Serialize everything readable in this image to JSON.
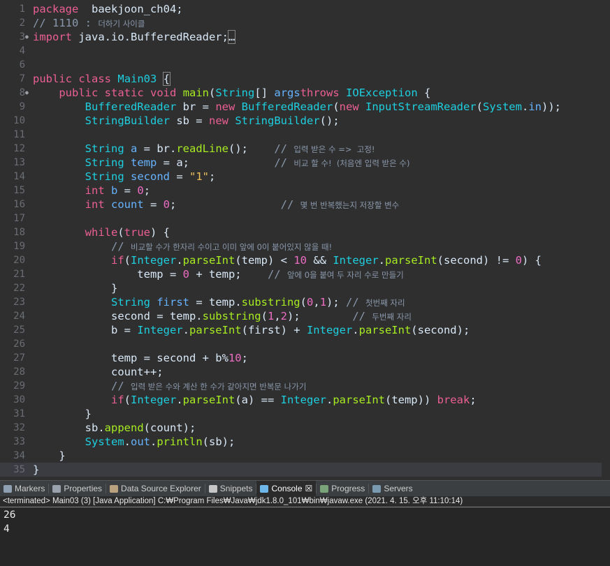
{
  "editor": {
    "lines": [
      {
        "n": "1",
        "segments": [
          [
            "kw",
            "package"
          ],
          [
            "",
            "  baekjoon_ch04;"
          ]
        ]
      },
      {
        "n": "2",
        "segments": [
          [
            "cmt",
            "// 1110 : "
          ],
          [
            "cmtk",
            "더하기 사이클"
          ]
        ]
      },
      {
        "n": "3",
        "fold": true,
        "segments": [
          [
            "kw",
            "import"
          ],
          [
            "",
            " java.io.BufferedReader;"
          ],
          [
            "brk",
            "…"
          ]
        ]
      },
      {
        "n": "4",
        "segments": []
      },
      {
        "n": "6",
        "segments": []
      },
      {
        "n": "7",
        "segments": [
          [
            "kw",
            "public"
          ],
          [
            "",
            " "
          ],
          [
            "kw",
            "class"
          ],
          [
            "",
            " "
          ],
          [
            "cls",
            "Main03"
          ],
          [
            "",
            " "
          ],
          [
            "brk",
            "{"
          ]
        ]
      },
      {
        "n": "8",
        "fold": true,
        "segments": [
          [
            "",
            "    "
          ],
          [
            "kw",
            "public"
          ],
          [
            "",
            " "
          ],
          [
            "kw",
            "static"
          ],
          [
            "",
            " "
          ],
          [
            "kw",
            "void"
          ],
          [
            "",
            " "
          ],
          [
            "meth",
            "main"
          ],
          [
            "",
            "("
          ],
          [
            "cls",
            "String"
          ],
          [
            "",
            "[] "
          ],
          [
            "fld",
            "args"
          ],
          [
            ") "
          ],
          [
            "kw",
            "throws"
          ],
          [
            "",
            " "
          ],
          [
            "cls",
            "IOException"
          ],
          [
            "",
            " {"
          ]
        ]
      },
      {
        "n": "9",
        "segments": [
          [
            "",
            "        "
          ],
          [
            "cls",
            "BufferedReader"
          ],
          [
            "",
            " br = "
          ],
          [
            "kw",
            "new"
          ],
          [
            "",
            " "
          ],
          [
            "cls",
            "BufferedReader"
          ],
          [
            "",
            "("
          ],
          [
            "kw",
            "new"
          ],
          [
            "",
            " "
          ],
          [
            "cls",
            "InputStreamReader"
          ],
          [
            "",
            "("
          ],
          [
            "cls",
            "System"
          ],
          [
            "",
            "."
          ],
          [
            "fld",
            "in"
          ],
          [
            "",
            "));"
          ]
        ]
      },
      {
        "n": "10",
        "segments": [
          [
            "",
            "        "
          ],
          [
            "cls",
            "StringBuilder"
          ],
          [
            "",
            " sb = "
          ],
          [
            "kw",
            "new"
          ],
          [
            "",
            " "
          ],
          [
            "cls",
            "StringBuilder"
          ],
          [
            "",
            "();"
          ]
        ]
      },
      {
        "n": "11",
        "segments": []
      },
      {
        "n": "12",
        "segments": [
          [
            "",
            "        "
          ],
          [
            "cls",
            "String"
          ],
          [
            "",
            " "
          ],
          [
            "fld",
            "a"
          ],
          [
            "",
            " = br."
          ],
          [
            "meth",
            "readLine"
          ],
          [
            "",
            "();    "
          ],
          [
            "cmt",
            "// "
          ],
          [
            "cmtk",
            "입력 받은 수 =>  고정!"
          ]
        ]
      },
      {
        "n": "13",
        "segments": [
          [
            "",
            "        "
          ],
          [
            "cls",
            "String"
          ],
          [
            "",
            " "
          ],
          [
            "fld",
            "temp"
          ],
          [
            "",
            " = a;             "
          ],
          [
            "cmt",
            "// "
          ],
          [
            "cmtk",
            "비교 할 수!  (처음엔 입력 받은 수)"
          ]
        ]
      },
      {
        "n": "14",
        "segments": [
          [
            "",
            "        "
          ],
          [
            "cls",
            "String"
          ],
          [
            "",
            " "
          ],
          [
            "fld",
            "second"
          ],
          [
            "",
            " = "
          ],
          [
            "str",
            "\"1\""
          ],
          [
            "",
            ";"
          ]
        ]
      },
      {
        "n": "15",
        "segments": [
          [
            "",
            "        "
          ],
          [
            "kw",
            "int"
          ],
          [
            "",
            " "
          ],
          [
            "fld",
            "b"
          ],
          [
            "",
            " = "
          ],
          [
            "num",
            "0"
          ],
          [
            "",
            ";"
          ]
        ]
      },
      {
        "n": "16",
        "segments": [
          [
            "",
            "        "
          ],
          [
            "kw",
            "int"
          ],
          [
            "",
            " "
          ],
          [
            "fld",
            "count"
          ],
          [
            "",
            " = "
          ],
          [
            "num",
            "0"
          ],
          [
            "",
            ";                "
          ],
          [
            "cmt",
            "// "
          ],
          [
            "cmtk",
            "몇 번 반복했는지 저장할 변수"
          ]
        ]
      },
      {
        "n": "17",
        "segments": []
      },
      {
        "n": "18",
        "segments": [
          [
            "",
            "        "
          ],
          [
            "kw",
            "while"
          ],
          [
            "",
            "("
          ],
          [
            "kw",
            "true"
          ],
          [
            "",
            ") {"
          ]
        ]
      },
      {
        "n": "19",
        "segments": [
          [
            "",
            "            "
          ],
          [
            "cmt",
            "// "
          ],
          [
            "cmtk",
            "비교할 수가 한자리 수이고 이미 앞에 0이 붙어있지 않을 때!"
          ]
        ]
      },
      {
        "n": "20",
        "segments": [
          [
            "",
            "            "
          ],
          [
            "kw",
            "if"
          ],
          [
            "",
            "("
          ],
          [
            "cls",
            "Integer"
          ],
          [
            "",
            "."
          ],
          [
            "meth",
            "parseInt"
          ],
          [
            "",
            "(temp) < "
          ],
          [
            "num",
            "10"
          ],
          [
            "",
            " && "
          ],
          [
            "cls",
            "Integer"
          ],
          [
            "",
            "."
          ],
          [
            "meth",
            "parseInt"
          ],
          [
            "",
            "(second) != "
          ],
          [
            "num",
            "0"
          ],
          [
            "",
            ") {"
          ]
        ]
      },
      {
        "n": "21",
        "segments": [
          [
            "",
            "                temp = "
          ],
          [
            "num",
            "0"
          ],
          [
            "",
            " + temp;    "
          ],
          [
            "cmt",
            "// "
          ],
          [
            "cmtk",
            "앞에 0을 붙여 두 자리 수로 만들기"
          ]
        ]
      },
      {
        "n": "22",
        "segments": [
          [
            "",
            "            }"
          ]
        ]
      },
      {
        "n": "23",
        "segments": [
          [
            "",
            "            "
          ],
          [
            "cls",
            "String"
          ],
          [
            "",
            " "
          ],
          [
            "fld",
            "first"
          ],
          [
            "",
            " = temp."
          ],
          [
            "meth",
            "substring"
          ],
          [
            "",
            "("
          ],
          [
            "num",
            "0"
          ],
          [
            "",
            ","
          ],
          [
            "num",
            "1"
          ],
          [
            "",
            "); "
          ],
          [
            "cmt",
            "// "
          ],
          [
            "cmtk",
            "첫번째 자리"
          ]
        ]
      },
      {
        "n": "24",
        "segments": [
          [
            "",
            "            second = temp."
          ],
          [
            "meth",
            "substring"
          ],
          [
            "",
            "("
          ],
          [
            "num",
            "1"
          ],
          [
            "",
            ","
          ],
          [
            "num",
            "2"
          ],
          [
            "",
            ");        "
          ],
          [
            "cmt",
            "// "
          ],
          [
            "cmtk",
            "두번째 자리"
          ]
        ]
      },
      {
        "n": "25",
        "segments": [
          [
            "",
            "            b = "
          ],
          [
            "cls",
            "Integer"
          ],
          [
            "",
            "."
          ],
          [
            "meth",
            "parseInt"
          ],
          [
            "",
            "(first) + "
          ],
          [
            "cls",
            "Integer"
          ],
          [
            "",
            "."
          ],
          [
            "meth",
            "parseInt"
          ],
          [
            "",
            "(second);"
          ]
        ]
      },
      {
        "n": "26",
        "segments": []
      },
      {
        "n": "27",
        "segments": [
          [
            "",
            "            temp = second + b%"
          ],
          [
            "num",
            "10"
          ],
          [
            "",
            ";"
          ]
        ]
      },
      {
        "n": "28",
        "segments": [
          [
            "",
            "            count++;"
          ]
        ]
      },
      {
        "n": "29",
        "segments": [
          [
            "",
            "            "
          ],
          [
            "cmt",
            "// "
          ],
          [
            "cmtk",
            "입력 받은 수와 계산 한 수가 같아지면 반복문 나가기"
          ]
        ]
      },
      {
        "n": "30",
        "segments": [
          [
            "",
            "            "
          ],
          [
            "kw",
            "if"
          ],
          [
            "",
            "("
          ],
          [
            "cls",
            "Integer"
          ],
          [
            "",
            "."
          ],
          [
            "meth",
            "parseInt"
          ],
          [
            "",
            "(a) == "
          ],
          [
            "cls",
            "Integer"
          ],
          [
            "",
            "."
          ],
          [
            "meth",
            "parseInt"
          ],
          [
            "",
            "(temp)) "
          ],
          [
            "kw",
            "break"
          ],
          [
            "",
            ";"
          ]
        ]
      },
      {
        "n": "31",
        "segments": [
          [
            "",
            "        }"
          ]
        ]
      },
      {
        "n": "32",
        "segments": [
          [
            "",
            "        sb."
          ],
          [
            "meth",
            "append"
          ],
          [
            "",
            "(count);"
          ]
        ]
      },
      {
        "n": "33",
        "segments": [
          [
            "",
            "        "
          ],
          [
            "cls",
            "System"
          ],
          [
            "",
            "."
          ],
          [
            "fld",
            "out"
          ],
          [
            "",
            "."
          ],
          [
            "meth",
            "println"
          ],
          [
            "",
            "(sb);"
          ]
        ]
      },
      {
        "n": "34",
        "segments": [
          [
            "",
            "    }"
          ]
        ]
      },
      {
        "n": "35",
        "current": true,
        "segments": [
          [
            "",
            "}"
          ]
        ]
      },
      {
        "n": "36",
        "segments": []
      }
    ]
  },
  "panel": {
    "tabs": [
      {
        "label": "Markers",
        "icon": "markers-icon",
        "active": false
      },
      {
        "label": "Properties",
        "icon": "properties-icon",
        "active": false
      },
      {
        "label": "Data Source Explorer",
        "icon": "data-source-icon",
        "active": false
      },
      {
        "label": "Snippets",
        "icon": "snippets-icon",
        "active": false
      },
      {
        "label": "Console",
        "icon": "console-icon",
        "active": true,
        "close": "☒"
      },
      {
        "label": "Progress",
        "icon": "progress-icon",
        "active": false
      },
      {
        "label": "Servers",
        "icon": "servers-icon",
        "active": false
      }
    ],
    "status": "<terminated> Main03 (3) [Java Application] C:₩Program Files₩Java₩jdk1.8.0_101₩bin₩javaw.exe (2021. 4. 15. 오후 11:10:14)",
    "output": [
      "26",
      "4"
    ]
  }
}
